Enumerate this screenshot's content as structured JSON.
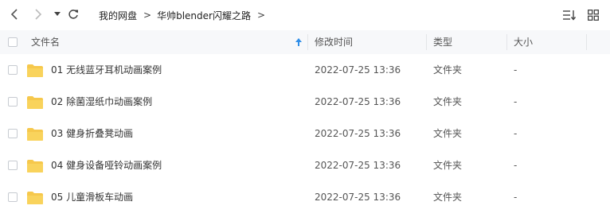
{
  "toolbar": {
    "breadcrumb": [
      {
        "label": "我的网盘"
      },
      {
        "label": "华帅blender闪耀之路"
      }
    ],
    "separator": ">"
  },
  "table": {
    "columns": {
      "name": "文件名",
      "modified": "修改时间",
      "type": "类型",
      "size": "大小"
    },
    "rows": [
      {
        "name": "01 无线蓝牙耳机动画案例",
        "modified": "2022-07-25 13:36",
        "type": "文件夹",
        "size": "-"
      },
      {
        "name": "02 除菌湿纸巾动画案例",
        "modified": "2022-07-25 13:36",
        "type": "文件夹",
        "size": "-"
      },
      {
        "name": "03 健身折叠凳动画",
        "modified": "2022-07-25 13:36",
        "type": "文件夹",
        "size": "-"
      },
      {
        "name": "04 健身设备哑铃动画案例",
        "modified": "2022-07-25 13:36",
        "type": "文件夹",
        "size": "-"
      },
      {
        "name": "05 儿童滑板车动画",
        "modified": "2022-07-25 13:36",
        "type": "文件夹",
        "size": "-"
      }
    ]
  },
  "colors": {
    "folder": "#f6c84c",
    "sort_arrow": "#2f8ee8",
    "header_bg": "#f7f8fa"
  },
  "icons": [
    "back-arrow-icon",
    "forward-arrow-icon",
    "dropdown-triangle-icon",
    "refresh-icon",
    "sort-list-icon",
    "grid-view-icon",
    "sort-ascending-icon",
    "folder-icon"
  ]
}
